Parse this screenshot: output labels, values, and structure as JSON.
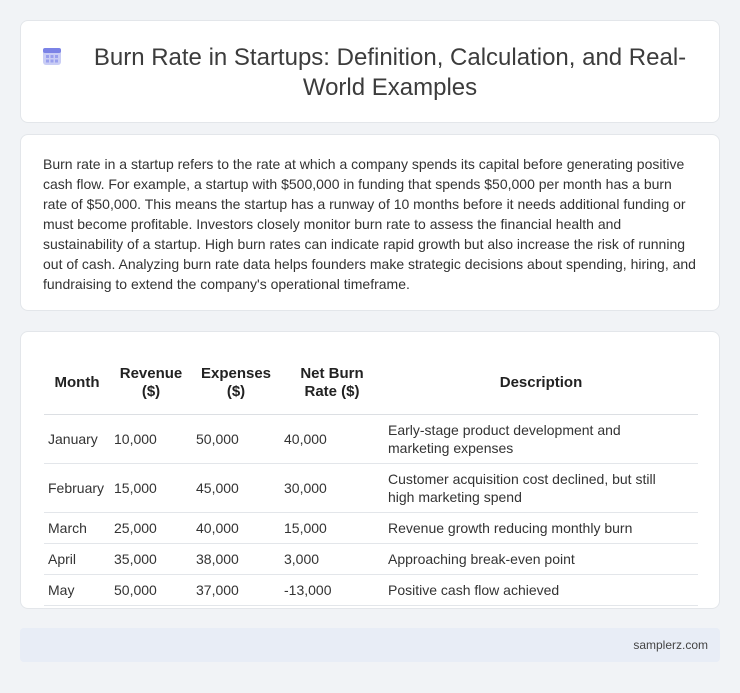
{
  "header": {
    "title": "Burn Rate in Startups: Definition, Calculation, and Real-World Examples",
    "icon": "calendar-icon",
    "accent": "#7b83e6"
  },
  "intro": {
    "text": "Burn rate in a startup refers to the rate at which a company spends its capital before generating positive cash flow. For example, a startup with $500,000 in funding that spends $50,000 per month has a burn rate of $50,000. This means the startup has a runway of 10 months before it needs additional funding or must become profitable. Investors closely monitor burn rate to assess the financial health and sustainability of a startup. High burn rates can indicate rapid growth but also increase the risk of running out of cash. Analyzing burn rate data helps founders make strategic decisions about spending, hiring, and fundraising to extend the company's operational timeframe."
  },
  "table": {
    "headers": [
      "Month",
      "Revenue ($)",
      "Expenses ($)",
      "Net Burn Rate ($)",
      "Description"
    ],
    "rows": [
      [
        "January",
        "10,000",
        "50,000",
        "40,000",
        "Early-stage product development and marketing expenses"
      ],
      [
        "February",
        "15,000",
        "45,000",
        "30,000",
        "Customer acquisition cost declined, but still high marketing spend"
      ],
      [
        "March",
        "25,000",
        "40,000",
        "15,000",
        "Revenue growth reducing monthly burn"
      ],
      [
        "April",
        "35,000",
        "38,000",
        "3,000",
        "Approaching break-even point"
      ],
      [
        "May",
        "50,000",
        "37,000",
        "-13,000",
        "Positive cash flow achieved"
      ]
    ]
  },
  "footer": {
    "source": "samplerz.com"
  }
}
